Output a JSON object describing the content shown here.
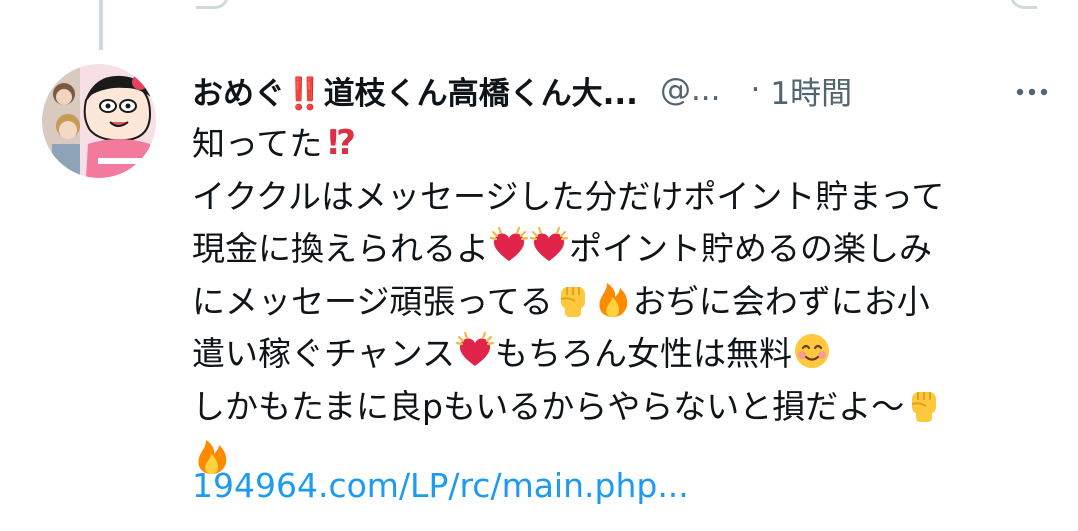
{
  "header": {
    "display_name": "おめぐ‼️道枝くん高橋くん大...",
    "handle": "@...",
    "separator": "·",
    "time": "1時間",
    "more_label": "···"
  },
  "tweet": {
    "lines": [
      [
        {
          "t": "text",
          "v": "知ってた"
        },
        {
          "t": "emoji",
          "icon": "interrobang-icon"
        }
      ],
      [
        {
          "t": "text",
          "v": "イククルはメッセージした分だけポイント貯まって"
        }
      ],
      [
        {
          "t": "text",
          "v": "現金に換えられるよ"
        },
        {
          "t": "emoji",
          "icon": "beating-heart-icon"
        },
        {
          "t": "emoji",
          "icon": "beating-heart-icon"
        },
        {
          "t": "text",
          "v": "ポイント貯めるの楽しみ"
        }
      ],
      [
        {
          "t": "text",
          "v": "にメッセージ頑張ってる"
        },
        {
          "t": "emoji",
          "icon": "raised-fist-icon"
        },
        {
          "t": "emoji",
          "icon": "fire-icon"
        },
        {
          "t": "text",
          "v": "おぢに会わずにお小"
        }
      ],
      [
        {
          "t": "text",
          "v": "遣い稼ぐチャンス"
        },
        {
          "t": "emoji",
          "icon": "beating-heart-icon"
        },
        {
          "t": "text",
          "v": "もちろん女性は無料"
        },
        {
          "t": "emoji",
          "icon": "smiling-face-icon"
        }
      ],
      [
        {
          "t": "text",
          "v": "しかもたまに良pもいるからやらないと損だよ〜"
        },
        {
          "t": "emoji",
          "icon": "raised-fist-icon"
        }
      ],
      [
        {
          "t": "emoji",
          "icon": "fire-icon"
        }
      ]
    ],
    "link": "194964.com/LP/rc/main.php..."
  },
  "colors": {
    "text": "#0f1419",
    "muted": "#536471",
    "link": "#1d9bf0",
    "thread_line": "#cfd9de",
    "heart": "#e0244a",
    "fist": "#ffc83d",
    "fire": "#ff8a00",
    "interrobang": "#dd2e44"
  },
  "avatar": {
    "icon": "avatar-collage-icon"
  }
}
